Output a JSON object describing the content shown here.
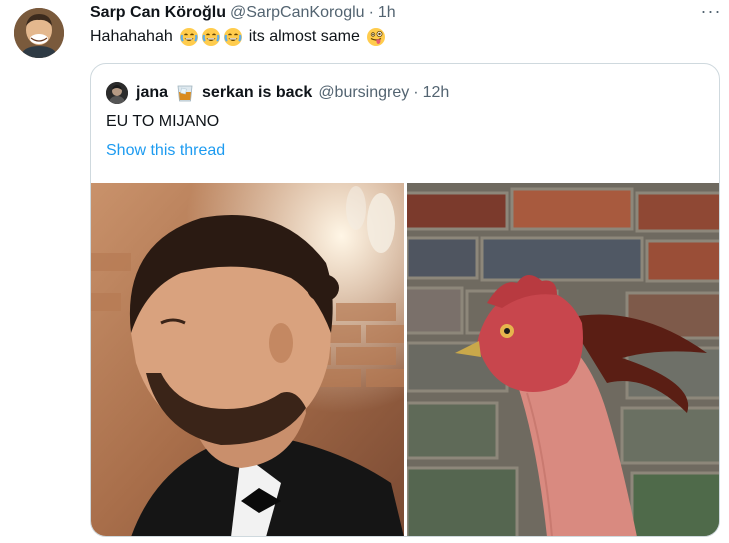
{
  "tweet": {
    "author_name": "Sarp Can Köroğlu",
    "handle": "@SarpCanKoroglu",
    "separator": "·",
    "time": "1h",
    "text_start": "Hahahahah",
    "text_end": "its almost same",
    "emojis": [
      "face-with-tears-of-joy-icon",
      "face-with-tears-of-joy-icon",
      "face-with-tears-of-joy-icon",
      "winking-face-with-tongue-icon"
    ],
    "more_label": "···"
  },
  "quote": {
    "name_part1": "jana",
    "name_emoji": "tumbler-glass-icon",
    "name_part2": "serkan is back",
    "handle": "@bursingrey",
    "separator": "·",
    "time": "12h",
    "text": "EU TO MIJANO",
    "show_thread": "Show this thread",
    "media": [
      "man-with-topknot-photo",
      "rooster-photo"
    ]
  }
}
